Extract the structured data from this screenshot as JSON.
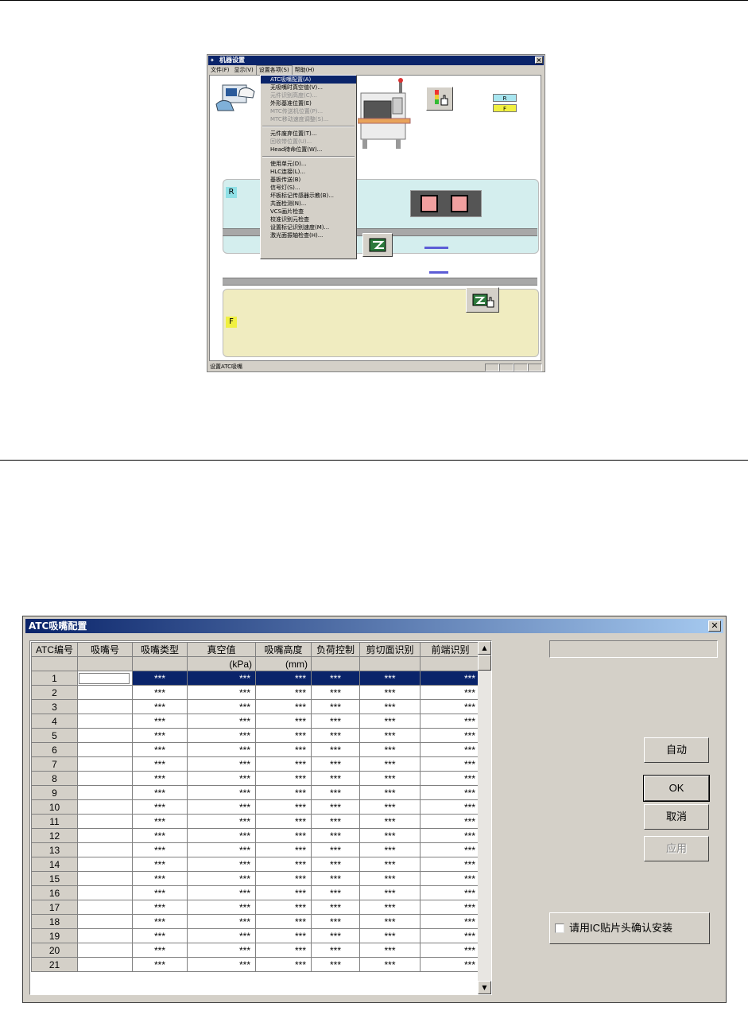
{
  "machine_window": {
    "title": "机器设置",
    "menu": [
      "文件(F)",
      "显示(V)",
      "设置各项(S)",
      "帮助(H)"
    ],
    "dropdown": [
      {
        "label": "ATC吸嘴配置(A)",
        "state": "selected"
      },
      {
        "label": "无吸嘴时真空值(V)...",
        "state": "normal"
      },
      {
        "label": "元件识别高度(C)...",
        "state": "disabled"
      },
      {
        "label": "外形基准位置(E)",
        "state": "normal"
      },
      {
        "label": "MTC传送机位置(P)...",
        "state": "disabled"
      },
      {
        "label": "MTC移动速度调整(S)...",
        "state": "disabled"
      },
      {
        "sep": true
      },
      {
        "label": "元件废弃位置(T)...",
        "state": "normal"
      },
      {
        "label": "回收带位置(U)...",
        "state": "disabled"
      },
      {
        "label": "Head待命位置(W)...",
        "state": "normal"
      },
      {
        "sep": true
      },
      {
        "label": "使用单元(D)...",
        "state": "normal"
      },
      {
        "label": "HLC连接(L)...",
        "state": "normal"
      },
      {
        "label": "基板传送(B)",
        "state": "normal"
      },
      {
        "label": "信号灯(S)...",
        "state": "normal"
      },
      {
        "label": "坏板标记传感器示教(B)...",
        "state": "normal"
      },
      {
        "label": "共面检测(N)...",
        "state": "normal"
      },
      {
        "label": "VCS画片检查",
        "state": "normal"
      },
      {
        "label": "校准识别元检查",
        "state": "normal"
      },
      {
        "label": "设置标记识别速度(M)...",
        "state": "normal"
      },
      {
        "label": "激光面振轴检查(H)...",
        "state": "normal"
      }
    ],
    "zone_r": "R",
    "zone_f": "F",
    "mini_r": "R",
    "mini_f": "F",
    "statusbar": "设置ATC吸嘴"
  },
  "dialog": {
    "title": "ATC吸嘴配置",
    "columns": [
      "ATC编号",
      "吸嘴号",
      "吸嘴类型",
      "真空值",
      "吸嘴高度",
      "负荷控制",
      "剪切面识别",
      "前端识别"
    ],
    "units": [
      "",
      "",
      "",
      "(kPa)",
      "(mm)",
      "",
      "",
      ""
    ],
    "rows": [
      [
        "1",
        "",
        "***",
        "***",
        "***",
        "***",
        "***",
        "***"
      ],
      [
        "2",
        "",
        "***",
        "***",
        "***",
        "***",
        "***",
        "***"
      ],
      [
        "3",
        "",
        "***",
        "***",
        "***",
        "***",
        "***",
        "***"
      ],
      [
        "4",
        "",
        "***",
        "***",
        "***",
        "***",
        "***",
        "***"
      ],
      [
        "5",
        "",
        "***",
        "***",
        "***",
        "***",
        "***",
        "***"
      ],
      [
        "6",
        "",
        "***",
        "***",
        "***",
        "***",
        "***",
        "***"
      ],
      [
        "7",
        "",
        "***",
        "***",
        "***",
        "***",
        "***",
        "***"
      ],
      [
        "8",
        "",
        "***",
        "***",
        "***",
        "***",
        "***",
        "***"
      ],
      [
        "9",
        "",
        "***",
        "***",
        "***",
        "***",
        "***",
        "***"
      ],
      [
        "10",
        "",
        "***",
        "***",
        "***",
        "***",
        "***",
        "***"
      ],
      [
        "11",
        "",
        "***",
        "***",
        "***",
        "***",
        "***",
        "***"
      ],
      [
        "12",
        "",
        "***",
        "***",
        "***",
        "***",
        "***",
        "***"
      ],
      [
        "13",
        "",
        "***",
        "***",
        "***",
        "***",
        "***",
        "***"
      ],
      [
        "14",
        "",
        "***",
        "***",
        "***",
        "***",
        "***",
        "***"
      ],
      [
        "15",
        "",
        "***",
        "***",
        "***",
        "***",
        "***",
        "***"
      ],
      [
        "16",
        "",
        "***",
        "***",
        "***",
        "***",
        "***",
        "***"
      ],
      [
        "17",
        "",
        "***",
        "***",
        "***",
        "***",
        "***",
        "***"
      ],
      [
        "18",
        "",
        "***",
        "***",
        "***",
        "***",
        "***",
        "***"
      ],
      [
        "19",
        "",
        "***",
        "***",
        "***",
        "***",
        "***",
        "***"
      ],
      [
        "20",
        "",
        "***",
        "***",
        "***",
        "***",
        "***",
        "***"
      ],
      [
        "21",
        "",
        "***",
        "***",
        "***",
        "***",
        "***",
        "***"
      ]
    ],
    "selected_row": 1,
    "buttons": {
      "auto": "自动",
      "ok": "OK",
      "cancel": "取消",
      "apply": "应用"
    },
    "checkbox_label": "请用IC贴片头确认安装",
    "checkbox_checked": false
  }
}
